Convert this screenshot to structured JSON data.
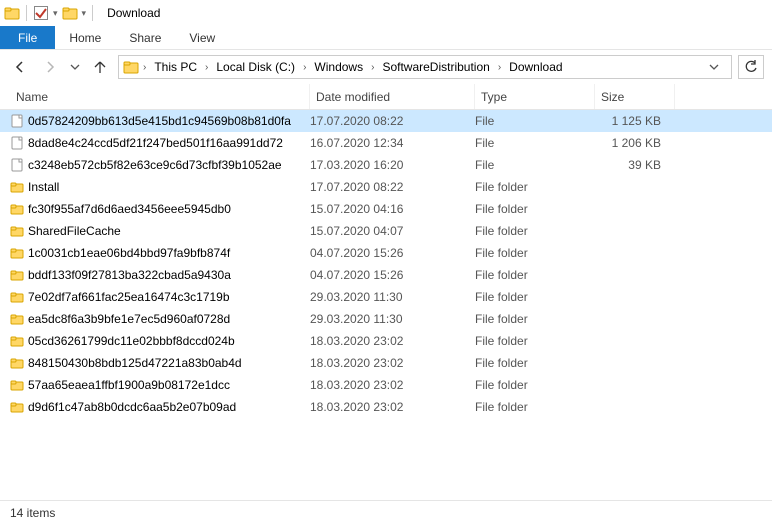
{
  "titlebar": {
    "app_title": "Download",
    "qat": {
      "icon1": "folder-icon",
      "icon2": "check-icon",
      "icon3": "folder-open-icon",
      "dropdown": "▾"
    }
  },
  "ribbon": {
    "file_label": "File",
    "tabs": [
      "Home",
      "Share",
      "View"
    ]
  },
  "nav": {
    "back": "←",
    "forward": "→",
    "recent": "⌄",
    "up": "↑",
    "breadcrumb": [
      "This PC",
      "Local Disk (C:)",
      "Windows",
      "SoftwareDistribution",
      "Download"
    ],
    "crumb_dropdown": "⌄",
    "refresh": "⟳"
  },
  "headers": {
    "name": "Name",
    "date": "Date modified",
    "type": "Type",
    "size": "Size"
  },
  "rows": [
    {
      "icon": "file",
      "name": "0d57824209bb613d5e415bd1c94569b08b81d0fa",
      "date": "17.07.2020 08:22",
      "type": "File",
      "size": "1 125 KB",
      "selected": true
    },
    {
      "icon": "file",
      "name": "8dad8e4c24ccd5df21f247bed501f16aa991dd72",
      "date": "16.07.2020 12:34",
      "type": "File",
      "size": "1 206 KB"
    },
    {
      "icon": "file",
      "name": "c3248eb572cb5f82e63ce9c6d73cfbf39b1052ae",
      "date": "17.03.2020 16:20",
      "type": "File",
      "size": "39 KB"
    },
    {
      "icon": "folder",
      "name": "Install",
      "date": "17.07.2020 08:22",
      "type": "File folder",
      "size": ""
    },
    {
      "icon": "folder",
      "name": "fc30f955af7d6d6aed3456eee5945db0",
      "date": "15.07.2020 04:16",
      "type": "File folder",
      "size": ""
    },
    {
      "icon": "folder",
      "name": "SharedFileCache",
      "date": "15.07.2020 04:07",
      "type": "File folder",
      "size": ""
    },
    {
      "icon": "folder",
      "name": "1c0031cb1eae06bd4bbd97fa9bfb874f",
      "date": "04.07.2020 15:26",
      "type": "File folder",
      "size": ""
    },
    {
      "icon": "folder",
      "name": "bddf133f09f27813ba322cbad5a9430a",
      "date": "04.07.2020 15:26",
      "type": "File folder",
      "size": ""
    },
    {
      "icon": "folder",
      "name": "7e02df7af661fac25ea16474c3c1719b",
      "date": "29.03.2020 11:30",
      "type": "File folder",
      "size": ""
    },
    {
      "icon": "folder",
      "name": "ea5dc8f6a3b9bfe1e7ec5d960af0728d",
      "date": "29.03.2020 11:30",
      "type": "File folder",
      "size": ""
    },
    {
      "icon": "folder",
      "name": "05cd36261799dc11e02bbbf8dccd024b",
      "date": "18.03.2020 23:02",
      "type": "File folder",
      "size": ""
    },
    {
      "icon": "folder",
      "name": "848150430b8bdb125d47221a83b0ab4d",
      "date": "18.03.2020 23:02",
      "type": "File folder",
      "size": ""
    },
    {
      "icon": "folder",
      "name": "57aa65eaea1ffbf1900a9b08172e1dcc",
      "date": "18.03.2020 23:02",
      "type": "File folder",
      "size": ""
    },
    {
      "icon": "folder",
      "name": "d9d6f1c47ab8b0dcdc6aa5b2e07b09ad",
      "date": "18.03.2020 23:02",
      "type": "File folder",
      "size": ""
    }
  ],
  "statusbar": {
    "count": "14 items"
  },
  "colors": {
    "accent": "#1979ca",
    "selection": "#cce8ff"
  }
}
